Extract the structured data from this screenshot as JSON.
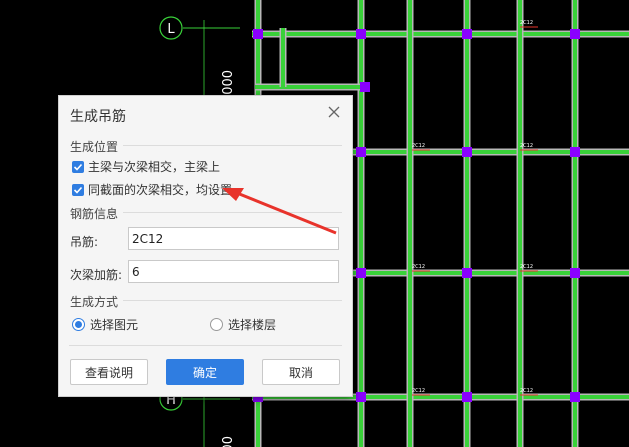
{
  "canvas": {
    "grid_label_top": "L",
    "grid_label_bottom": "H",
    "dim_text": "000",
    "rebar_labels": [
      "2C12",
      "2C12",
      "2C12",
      "2C12",
      "2C12",
      "2C12",
      "2C12",
      "2C12"
    ],
    "colors": {
      "beam": "#39d139",
      "beam_edge": "#b8b8b8",
      "column": "#8a00ff",
      "axis": "#39d139",
      "arrow": "#e8332b"
    }
  },
  "dialog": {
    "title": "生成吊筋",
    "close_icon": "close-icon",
    "position_section": "生成位置",
    "checkbox1_label": "主梁与次梁相交，主梁上",
    "checkbox2_label": "同截面的次梁相交，均设置",
    "rebar_section": "钢筋信息",
    "hanger_label": "吊筋:",
    "hanger_value": "2C12",
    "secondary_label": "次梁加筋:",
    "secondary_value": "6",
    "method_section": "生成方式",
    "radio_element": "选择图元",
    "radio_floor": "选择楼层",
    "help_button": "查看说明",
    "ok_button": "确定",
    "cancel_button": "取消"
  }
}
